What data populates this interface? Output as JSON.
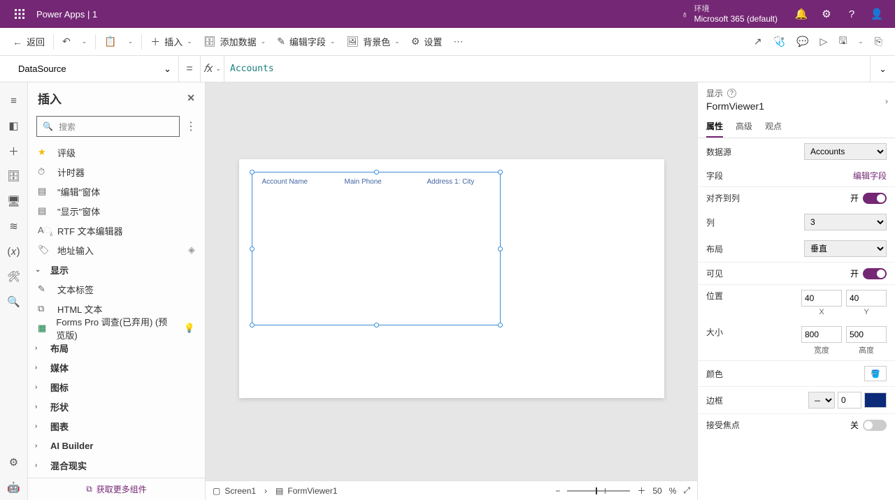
{
  "header": {
    "title": "Power Apps  |  1",
    "env_label": "环境",
    "env_value": "Microsoft 365 (default)"
  },
  "toolbar": {
    "back": "返回",
    "insert": "插入",
    "add_data": "添加数据",
    "edit_fields": "编辑字段",
    "bg": "背景色",
    "settings": "设置"
  },
  "formula": {
    "property": "DataSource",
    "code": "Accounts"
  },
  "insert_panel": {
    "title": "插入",
    "search_placeholder": "搜索",
    "items": [
      "评级",
      "计时器",
      "\"编辑\"窗体",
      "\"显示\"窗体",
      "RTF 文本编辑器",
      "地址输入"
    ],
    "group_display": "显示",
    "display_items": [
      "文本标签",
      "HTML 文本",
      "Forms Pro 调查(已弃用) (预览版)"
    ],
    "groups": [
      "布局",
      "媒体",
      "图标",
      "形状",
      "图表",
      "AI Builder",
      "混合现实"
    ],
    "footer": "获取更多组件"
  },
  "canvas": {
    "col1": "Account Name",
    "col2": "Main Phone",
    "col3": "Address 1: City"
  },
  "status": {
    "screen": "Screen1",
    "control": "FormViewer1",
    "zoom_value": "50",
    "zoom_unit": "%"
  },
  "props": {
    "section": "显示",
    "control_name": "FormViewer1",
    "tabs": [
      "属性",
      "高级",
      "观点"
    ],
    "datasource_label": "数据源",
    "datasource_value": "Accounts",
    "fields_label": "字段",
    "fields_link": "编辑字段",
    "snap_label": "对齐到列",
    "snap_value": "开",
    "cols_label": "列",
    "cols_value": "3",
    "layout_label": "布局",
    "layout_value": "垂直",
    "visible_label": "可见",
    "visible_value": "开",
    "pos_label": "位置",
    "pos_x": "40",
    "pos_y": "40",
    "x_lbl": "X",
    "y_lbl": "Y",
    "size_label": "大小",
    "size_w": "800",
    "size_h": "500",
    "w_lbl": "宽度",
    "h_lbl": "高度",
    "color_label": "颜色",
    "border_label": "边框",
    "border_value": "0",
    "focus_label": "接受焦点",
    "focus_value": "关"
  }
}
